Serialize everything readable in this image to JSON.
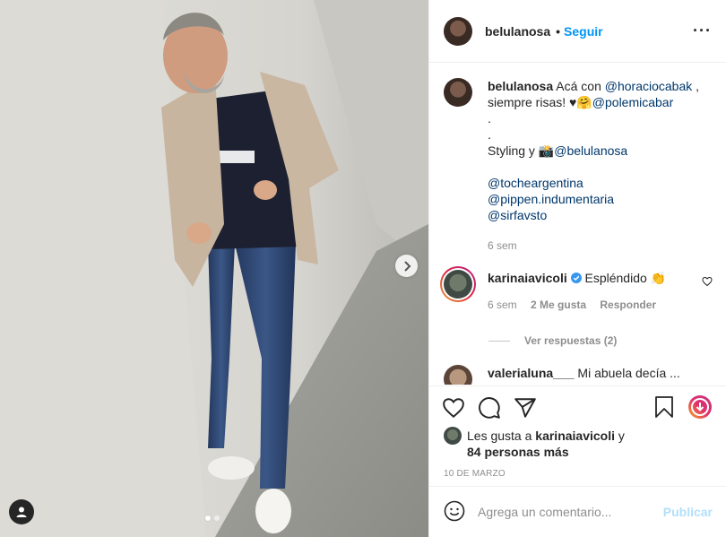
{
  "post": {
    "username": "belulanosa",
    "separator": "•",
    "follow_label": "Seguir",
    "more_label": "···"
  },
  "caption": {
    "username": "belulanosa",
    "text_1": "Acá con",
    "mention_1": "@horaciocabak",
    "text_2": ",",
    "text_3": "siempre risas! ♥",
    "emoji_1": "🤗",
    "mention_2": "@polemicabar",
    "dot_1": ".",
    "dot_2": ".",
    "styling": "Styling y",
    "emoji_2": "📸",
    "mention_3": "@belulanosa",
    "mention_4": "@tocheargentina",
    "mention_5": "@pippen.indumentaria",
    "mention_6": "@sirfavsto",
    "time": "6 sem"
  },
  "comments": [
    {
      "username": "karinaiavicoli",
      "verified": true,
      "text": "Espléndido 👏",
      "time": "6 sem",
      "likes": "2 Me gusta",
      "reply": "Responder",
      "view_replies": "Ver respuestas (2)"
    },
    {
      "username": "valerialuna___",
      "text": "Mi abuela decía ..."
    }
  ],
  "likes": {
    "prefix": "Les gusta a",
    "user": "karinaiavicoli",
    "suffix": "y",
    "others": "84 personas más"
  },
  "date": "10 de marzo",
  "add_comment": {
    "placeholder": "Agrega un comentario...",
    "publish_label": "Publicar"
  },
  "carousel": {
    "count": 2,
    "active_index": 0
  },
  "colors": {
    "accent": "#0095f6",
    "publish_disabled": "#b2dffc",
    "mention": "#00376b",
    "muted": "#8e8e8e"
  },
  "icons": [
    "heart-icon",
    "comment-icon",
    "share-icon",
    "bookmark-icon",
    "igtv-icon",
    "emoji-icon",
    "next-arrow-icon",
    "user-tag-icon",
    "verified-icon"
  ]
}
